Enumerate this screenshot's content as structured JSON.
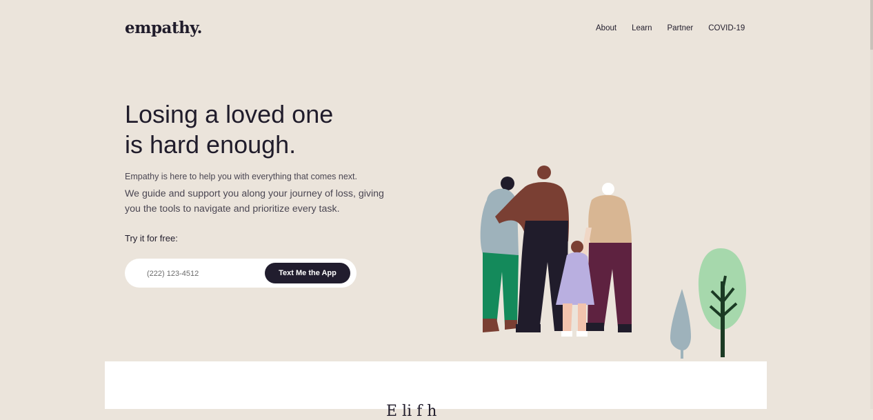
{
  "header": {
    "logo": "empathy.",
    "nav": [
      {
        "label": "About"
      },
      {
        "label": "Learn"
      },
      {
        "label": "Partner"
      },
      {
        "label": "COVID-19"
      }
    ]
  },
  "hero": {
    "title_line1": "Losing a loved one",
    "title_line2": "is hard enough.",
    "subtitle": "Empathy is here to help you with everything that comes next.",
    "body": "We guide and support you along your journey of loss, giving you the tools to navigate and prioritize every task.",
    "try_label": "Try it for free:",
    "phone_placeholder": "(222) 123-4512",
    "cta_label": "Text Me the App"
  },
  "illustration": {
    "icons": [
      "moon-icon",
      "family-illustration",
      "tree-icon"
    ],
    "colors": {
      "background": "#ebe4db",
      "accent_dark": "#211d2e",
      "green_tree": "#a6d8ac",
      "blue_tree": "#9eb2bb"
    }
  },
  "next_section": {
    "heading_peek": "E li f h"
  }
}
